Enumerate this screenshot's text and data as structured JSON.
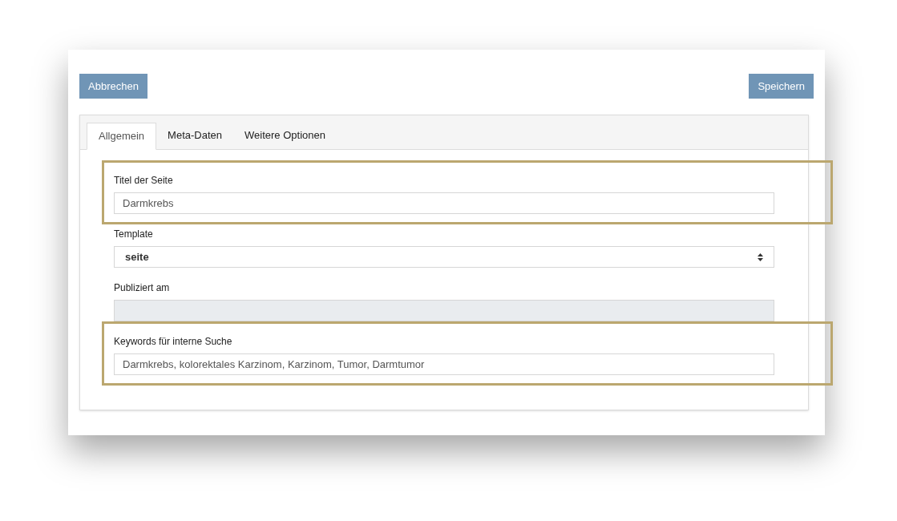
{
  "buttons": [
    {
      "label": "Abbrechen",
      "kind": "cancel"
    },
    {
      "label": "Speichern",
      "kind": "save"
    }
  ],
  "tabs": [
    {
      "label": "Allgemein",
      "selected": true
    },
    {
      "label": "Meta-Daten",
      "selected": false
    },
    {
      "label": "Weitere Optionen",
      "selected": false
    }
  ],
  "fields": [
    {
      "label": "Titel der Seite",
      "kind": "text",
      "value": "Darmkrebs",
      "highlighted": true,
      "disabled": false
    },
    {
      "label": "Template",
      "kind": "select",
      "value": "seite",
      "highlighted": false,
      "disabled": false
    },
    {
      "label": "Publiziert am",
      "kind": "text",
      "highlighted": false,
      "disabled": true
    },
    {
      "label": "Keywords für interne Suche",
      "kind": "text",
      "value": "Darmkrebs, kolorektales Karzinom, Karzinom, Tumor, Darmtumor",
      "highlighted": true,
      "disabled": false
    }
  ]
}
